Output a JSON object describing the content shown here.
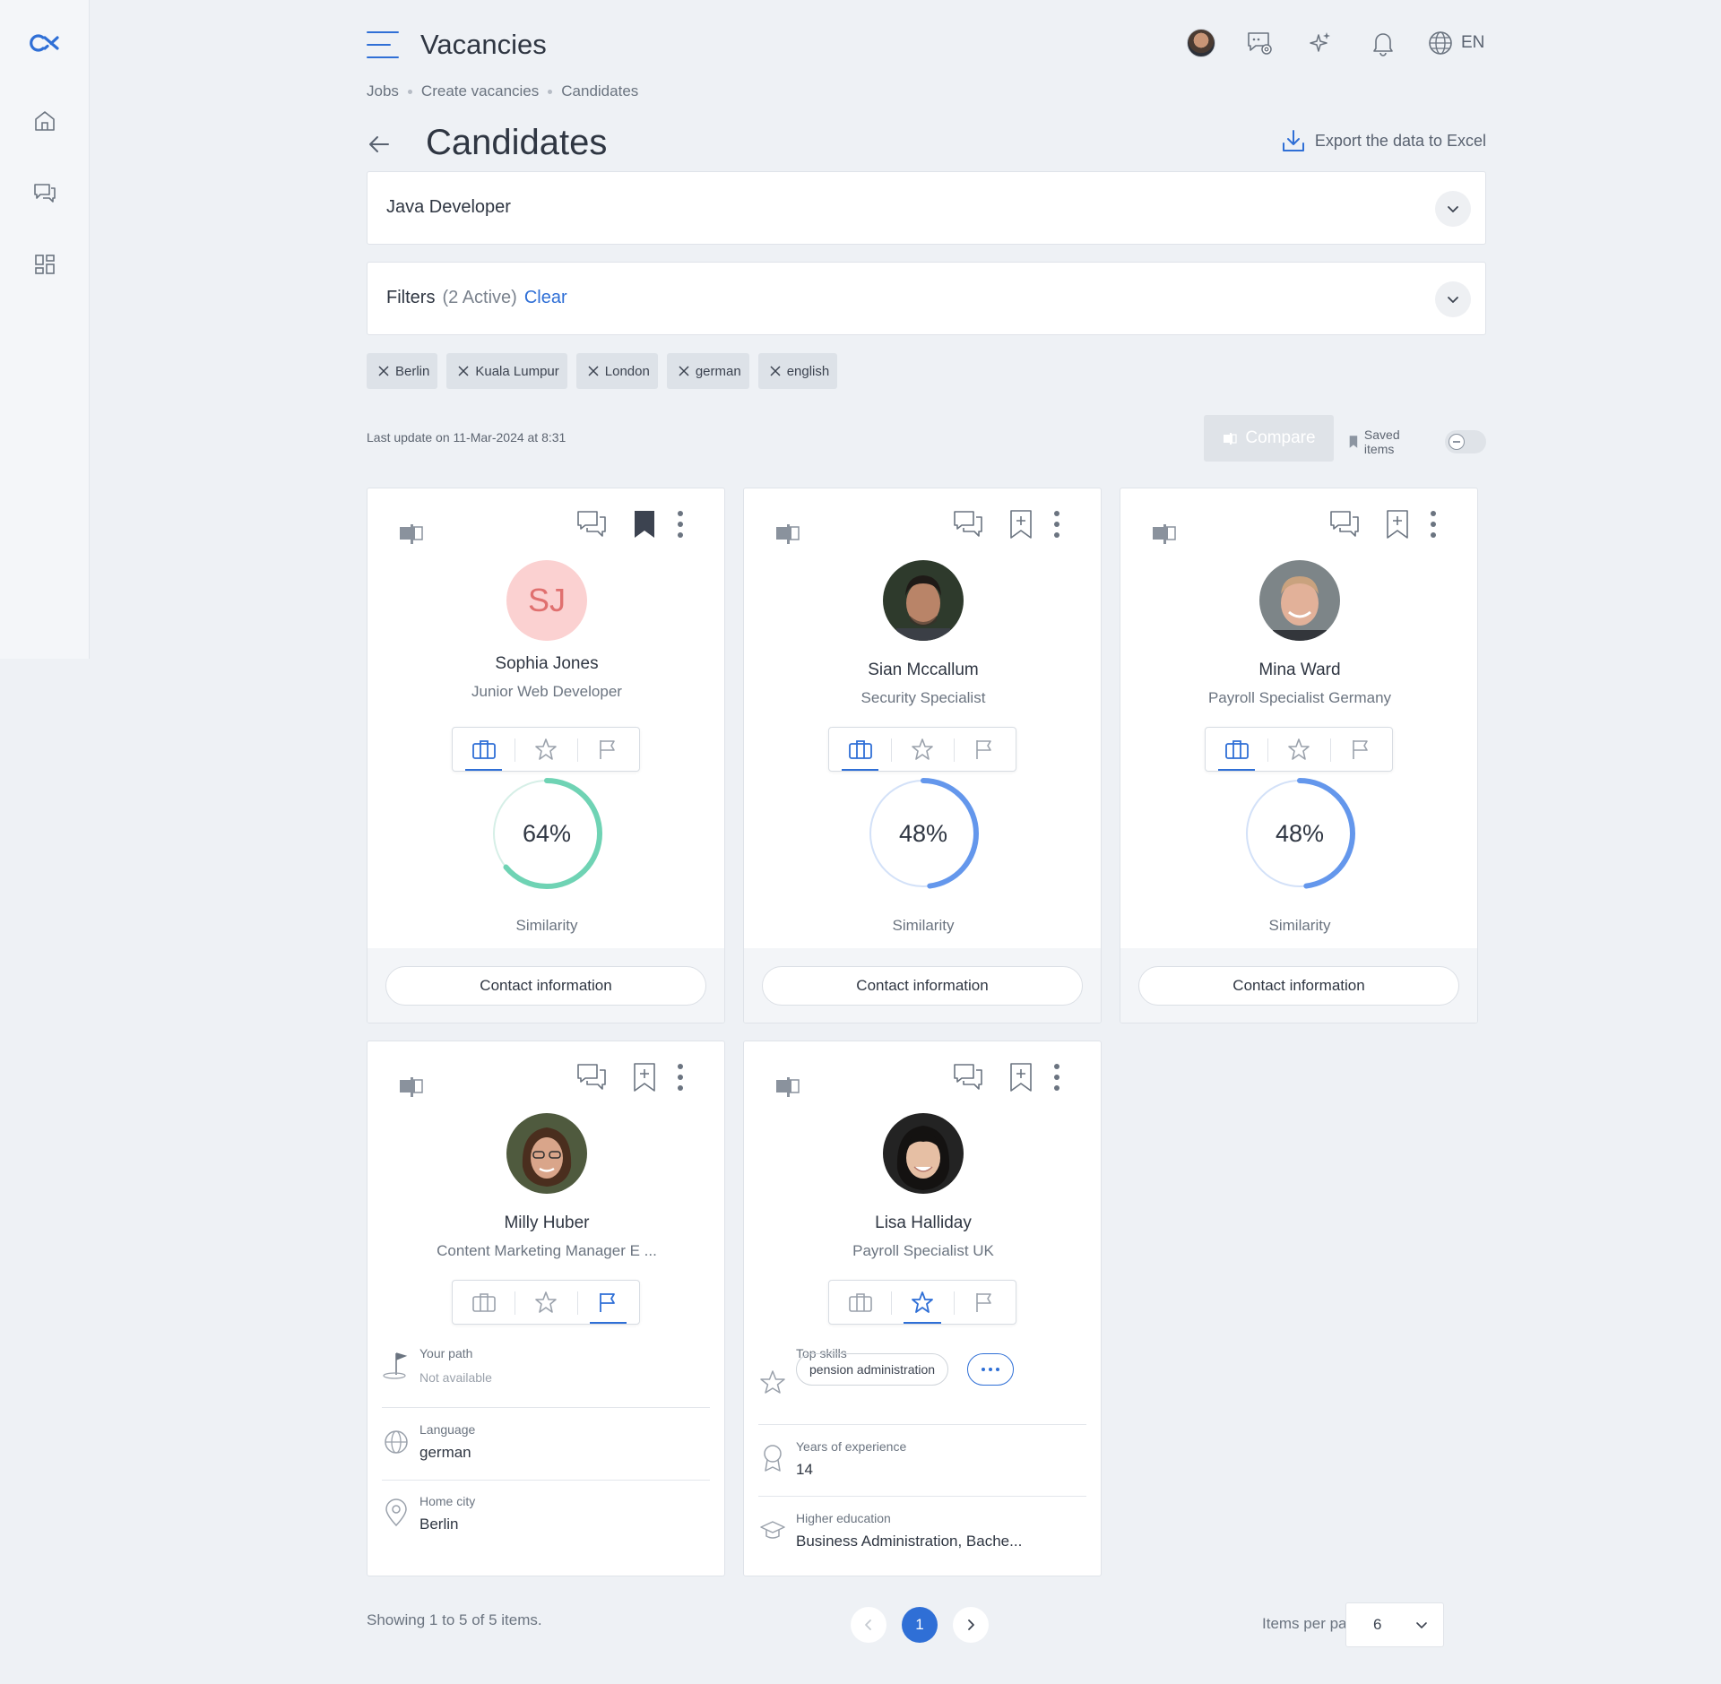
{
  "header": {
    "app_title": "Vacancies",
    "language": "EN"
  },
  "breadcrumb": [
    "Jobs",
    "Create vacancies",
    "Candidates"
  ],
  "page": {
    "title": "Candidates",
    "export_label": "Export the data to Excel"
  },
  "vacancy_select": {
    "value": "Java Developer"
  },
  "filters": {
    "label": "Filters",
    "active_count": "(2 Active)",
    "clear_label": "Clear",
    "chips": [
      "Berlin",
      "Kuala Lumpur",
      "London",
      "german",
      "english"
    ]
  },
  "toolbar": {
    "last_update": "Last update on 11-Mar-2024 at 8:31",
    "compare_label": "Compare",
    "saved_items_label": "Saved items",
    "saved_items_on": false
  },
  "candidates": [
    {
      "name": "Sophia Jones",
      "title": "Junior Web Developer",
      "initials": "SJ",
      "avatar": "initials",
      "bookmarked": true,
      "active_tab": "job",
      "similarity": "64%",
      "similarity_value": 0.64,
      "similarity_color": "#6fd3b4",
      "similarity_label": "Similarity",
      "contact_label": "Contact information"
    },
    {
      "name": "Sian Mccallum",
      "title": "Security Specialist",
      "avatar": "photo-man-dark-hair",
      "bookmarked": false,
      "active_tab": "job",
      "similarity": "48%",
      "similarity_value": 0.48,
      "similarity_color": "#6497ec",
      "similarity_label": "Similarity",
      "contact_label": "Contact information"
    },
    {
      "name": "Mina Ward",
      "title": "Payroll Specialist Germany",
      "avatar": "photo-man-blond",
      "bookmarked": false,
      "active_tab": "job",
      "similarity": "48%",
      "similarity_value": 0.48,
      "similarity_color": "#6497ec",
      "similarity_label": "Similarity",
      "contact_label": "Contact information"
    },
    {
      "name": "Milly Huber",
      "title": "Content Marketing Manager E ...",
      "avatar": "photo-woman-glasses",
      "bookmarked": false,
      "active_tab": "path",
      "path_label": "Your path",
      "path_value": "Not available",
      "language_label": "Language",
      "language_value": "german",
      "city_label": "Home city",
      "city_value": "Berlin"
    },
    {
      "name": "Lisa Halliday",
      "title": "Payroll Specialist UK",
      "avatar": "photo-woman-dark-hair",
      "bookmarked": false,
      "active_tab": "skills",
      "skills_label": "Top skills",
      "skills": [
        "pension administration"
      ],
      "experience_label": "Years of experience",
      "experience_value": "14",
      "education_label": "Higher education",
      "education_value": "Business Administration, Bache..."
    }
  ],
  "pagination": {
    "summary": "Showing 1 to 5 of 5 items.",
    "current_page": "1",
    "items_per_page_label": "Items per page",
    "items_per_page": "6"
  },
  "colors": {
    "accent": "#2f6fd6",
    "similarity_green": "#6fd3b4",
    "similarity_blue": "#6497ec"
  }
}
